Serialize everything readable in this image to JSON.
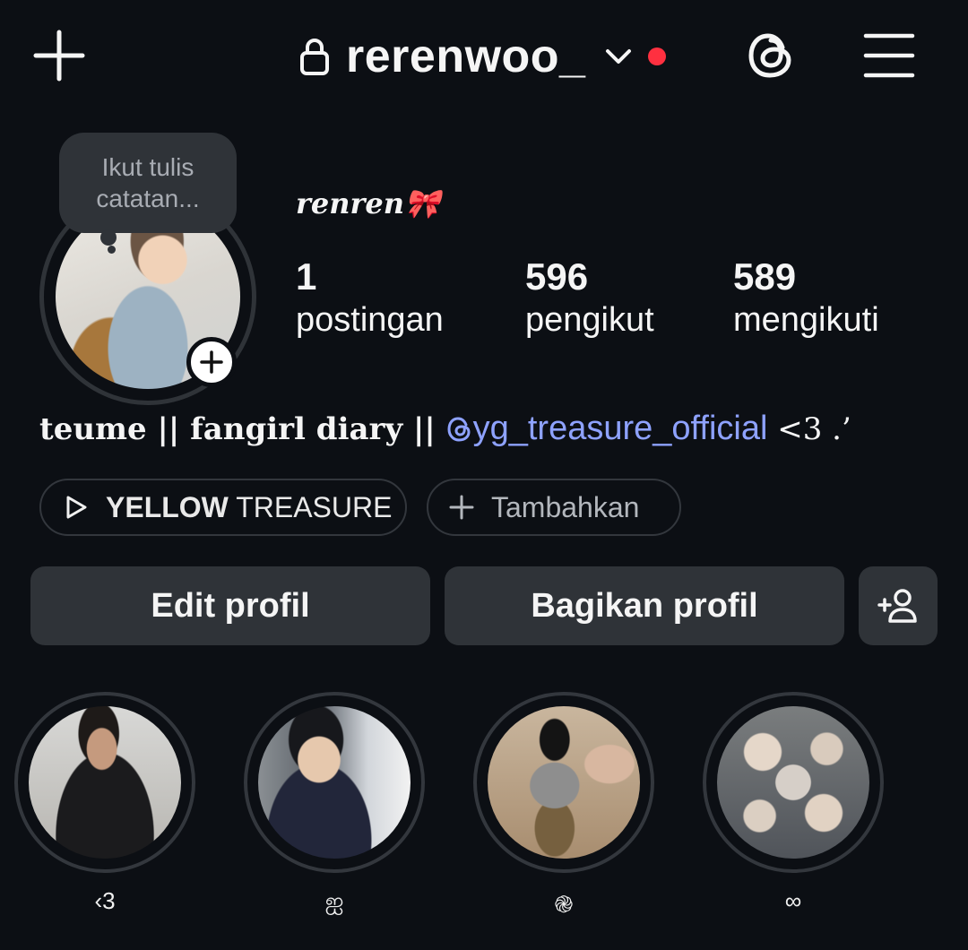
{
  "header": {
    "username": "rerenwoo_",
    "icons": {
      "new": "plus-icon",
      "lock": "lock-icon",
      "account_switch": "chevron-down-icon",
      "threads": "threads-icon",
      "menu": "hamburger-icon"
    },
    "notification_dot_color": "#ff3040"
  },
  "profile": {
    "note_placeholder": [
      "Ikut tulis",
      "catatan..."
    ],
    "display_name": "renren🎀",
    "stats": [
      {
        "value": "1",
        "label": "postingan"
      },
      {
        "value": "596",
        "label": "pengikut"
      },
      {
        "value": "589",
        "label": "mengikuti"
      }
    ],
    "bio": {
      "text": "teume || fangirl diary || ",
      "mention": "yg_treasure_official",
      "tail": " <3 .’"
    },
    "mention_color": "#8ea2ff"
  },
  "chips": {
    "music_bold": "YELLOW",
    "music_rest": " TREASURE",
    "add_label": "Tambahkan"
  },
  "buttons": {
    "edit": "Edit profil",
    "share": "Bagikan profil"
  },
  "highlights": [
    {
      "label": "‹3"
    },
    {
      "label": "ஐ"
    },
    {
      "label": "֎"
    },
    {
      "label": "∞"
    },
    {
      "label": ""
    }
  ]
}
